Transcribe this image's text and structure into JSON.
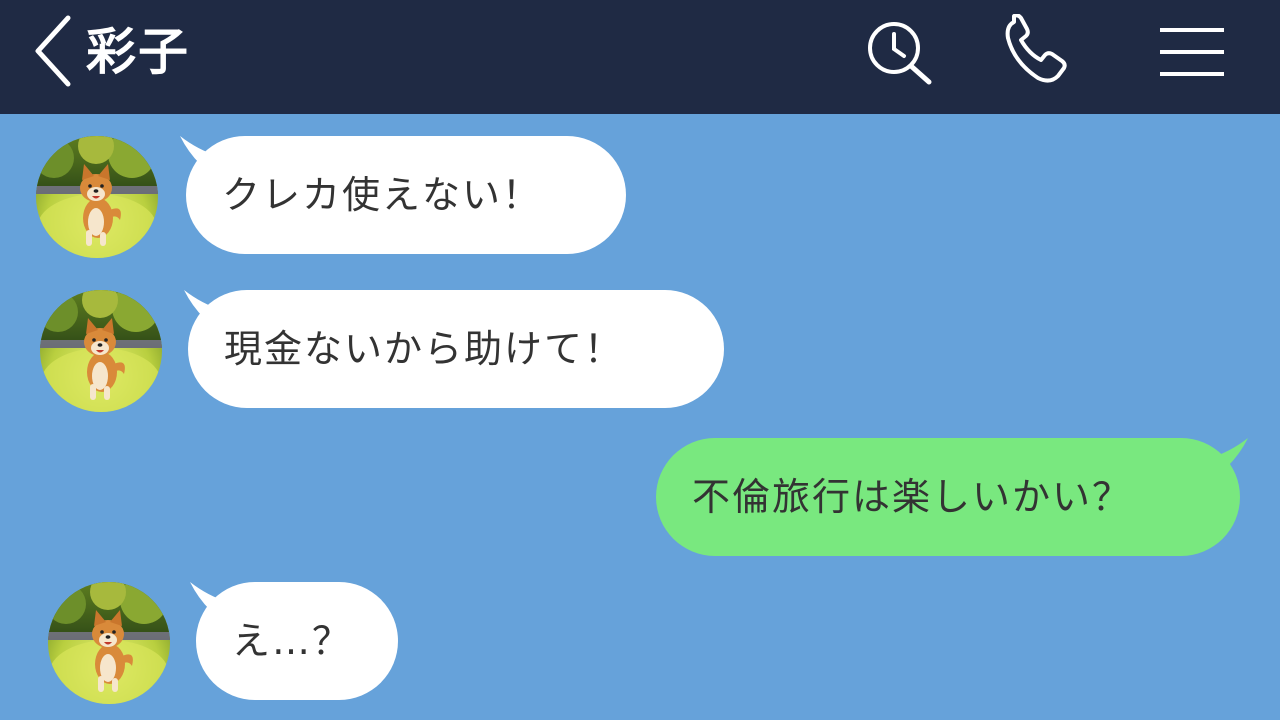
{
  "header": {
    "title": "彩子",
    "icons": {
      "back": "chevron-left-icon",
      "search": "search-clock-icon",
      "call": "phone-icon",
      "menu": "hamburger-menu-icon"
    }
  },
  "colors": {
    "header_bg": "#1f2a44",
    "chat_bg": "#66a2da",
    "incoming_bubble": "#ffffff",
    "outgoing_bubble": "#79e87f",
    "text": "#333333"
  },
  "messages": [
    {
      "sender": "contact",
      "text": "クレカ使えない！"
    },
    {
      "sender": "contact",
      "text": "現金ないから助けて！"
    },
    {
      "sender": "me",
      "text": "不倫旅行は楽しいかい？"
    },
    {
      "sender": "contact",
      "text": "え…？"
    }
  ]
}
